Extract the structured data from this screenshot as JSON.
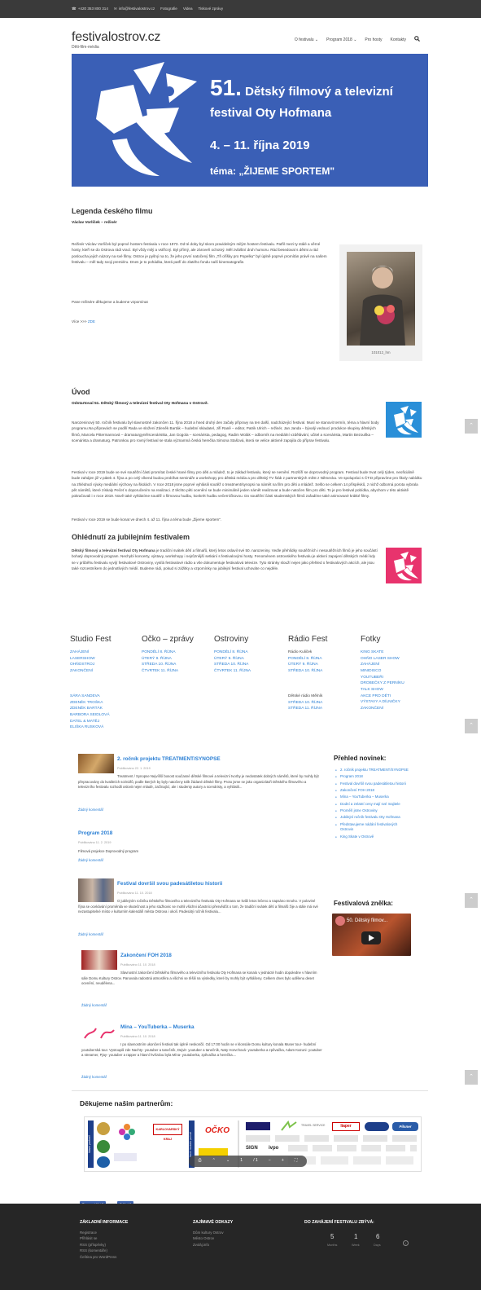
{
  "topbar": {
    "phone": "+420 353 800 314",
    "email": "info@festivalostrov.cz",
    "links": [
      "Fotografie",
      "Videa",
      "Tiskové zprávy"
    ]
  },
  "site": {
    "title": "festivalostrov.cz",
    "subtitle": "Děti-film-média"
  },
  "nav": {
    "items": [
      "O festivalu",
      "Program 2018",
      "Pro hosty",
      "Kontakty"
    ]
  },
  "banner": {
    "number": "51.",
    "line1": "Dětský filmový a televizní",
    "line2": "festival Oty Hofmana",
    "dates": "4. – 11. října 2019",
    "theme": "téma: „ŽIJEME SPORTEM\""
  },
  "legenda": {
    "title": "Legenda českého filmu",
    "subtitle": "Václav Vorlíček – režisér",
    "text": "Režisér Václav Vorlíček byl poprvé hostem festivalu v roce 1973. Od té doby byl skoro pravidelným milým hostem festivalu. Patřil mezi ty stálé a věrné hosty, kteří se do Ostrova rádi vrací. Byl vždy milý a vstřícný. Byl přímý, ale zároveň ochotný. Měl zvláštní druh humoru. Rád besedoval s dětmi a rád posloucha jejich názory na své filmy. Ostrov je pyšný na to, že jeho první natočený film „Tři oříšky pro Popelku\" byl úplně poprvé promítán právě na našem festivalu – měl tady svoji premiéru. Dnes je to pohádka, která patří do zlatého fondu naší kinematografie.",
    "thanks": "Pane režisére děkujeme a budeme vzpomínat",
    "more": "Více >>>",
    "more_link": "ZDE",
    "photo_caption": "101012_hm"
  },
  "uvod": {
    "title": "Úvod",
    "subtitle": "Odstartoval 51. Dětský filmový a televizní festival Oty Hofmana v Ostrově.",
    "p1": "Narozeninový 50. ročník festivalu byl slavnostně zakončen 11. října 2018 a hned druhý den začaly přípravy na ten další, nadcházející festival. Musí se stanovit termín, téma a hlavní body programu.Na přípravách se podílí Rada ve složení Zdeněk Barták – hudební skladatel, Jiří Raně – editor, Patrik Ulrich – režisér, Jan Janda – bývalý vedoucí produkce skupiny dětských filmů, Marcela Pittermannová – dramaturgyně/scenáristka, Jan Gogola – scenárista, pedagog, Radim Wolák – odborník na mediální vzdělávání, učitel a scenárista, Martin Bezouška – scenárista a dramaturg. Patronkou pro rovný festival se stala významná česká herečka Simona Stašová, která se velice aktivně zapojila do příprav festivalu.",
    "p2": "Festival v roce 2019 bude ve své soutěžní části promítat české hrané filmy pro děti a mládež, to je základ festivalu, který se nemění. Rozšíří se doprovodný program. Festival bude trvat celý týden, neoficiálně bude zahájen již v pátek 4. října a po celý víkend budou probíhat semináře a workshopy pro dětská média a pro dětský TV štáb z partnerských měst z Německa. Ve spolupráci s ČT:D připravíme pro školy nabídku na zhlédnutí výuky mediální výchovy na školách. V roce 2018 jsme poprvé vyhlásili soutěž o treatment/synopsi na námět na film pro děti a mládež. Sešlo se celkem 14 příspěvků, z nichž odborná porota vybrala pět námětů, které získaly Pečeť s doporučením na realizaci. Z těchto pěti ocenění se bude minimálně jeden námět realizovat a bude natočen film pro děti. To je pro festival pobídka, abychom v této aktivitě pokračovali i v roce 2019. Nově také vyhlásíme soutěž o filmovou hudbu, konkrét hudbu večerníčkovou. Do soutěžní části studentských filmů zařadíme také animované krátké filmy.",
    "p3": "Festival v roce 2019 se bude konat ve dnech 4. až 11. října a téma bude „Žijeme sportem\"."
  },
  "ohlednuti": {
    "title": "Ohlédnutí za jubilejním festivalem",
    "lead": "Dětský filmový a televizní festival Oty Hofmana",
    "text": " je tradiční svátek dětí a filmařů, který letos oslavil své 50. narozeniny. Vedle přehlídky soutěžních i nesoutěžních filmů je jeho součástí bohatý doprovodný program. Nechybí koncerty, výstavy, workshopy i nejrůznější setkání s festivalovými hosty. Fenoménem ostrovského festivalu je aktivní zapojení dětských médií kdy se v průběhu festivalu vyvíjí festivalové Ostroviny, vysílá festivalové rádio a vše dokumentuje festivalová televize. Tyto stránky slouží nejen jako přehled o festivalových akcích, ale jsou také rozcestníkem do jednotlivých médií. Budeme rádi, pokud si zážitky a vzpomínky na jubilejní festival uchováte co nejdéle."
  },
  "columns": [
    {
      "title": "Studio Fest",
      "items": [
        "ZAHÁJENÍ",
        "LASERSHOW",
        "OHŇOSTROJ",
        "ZAKONČENÍ"
      ],
      "items2": [
        "SÁRA SANDEVA",
        "ZDENĚK TROŠKA",
        "ZDENĚK BARTÁK",
        "BARBORA SEIDLOVÁ",
        "DATEL & MATĚJ",
        "ELIŠKA RUSKOVÁ"
      ]
    },
    {
      "title": "Očko – zprávy",
      "items": [
        "PONDĚLÍ 8. ŘÍJNA",
        "ÚTERÝ 9. ŘÍJNA",
        "STŘEDA 10. ŘÍJNA",
        "ČTVRTEK 11. ŘÍJNA"
      ]
    },
    {
      "title": "Ostroviny",
      "items": [
        "PONDĚLÍ 8. ŘÍJNA",
        "ÚTERÝ 9. ŘÍJNA",
        "STŘEDA 10. ŘÍJNA",
        "ČTVRTEK 11. ŘÍJNA"
      ]
    },
    {
      "title": "Rádio Fest",
      "plain1": "Rádio Kuliček",
      "items": [
        "PONDĚLÍ 8. ŘÍJNA",
        "ÚTERÝ 9. ŘÍJNA",
        "STŘEDA 10. ŘÍJNA"
      ],
      "plain2": "Dětské rádio Mělník",
      "items2": [
        "STŘEDA 10. ŘÍJNA",
        "STŘEDA 11. ŘÍJNA"
      ]
    },
    {
      "title": "Fotky",
      "items": [
        "KING SKATE",
        "OHŇO LASER SHOW",
        "ZAHÁJENÍ",
        "MINIDISCO",
        "YOUTUBEŘI",
        "DROBEČKY Z PERNÍKU",
        "TALK SHOW",
        "AKCE PRO DĚTI",
        "VÝSTAVY A DÍLNIČKY",
        "ZAKONČENÍ"
      ]
    }
  ],
  "posts": [
    {
      "title": "2. ročník projektu TREATMENT/SYNOPSE",
      "meta": "Publikováno 22. 1. 2019",
      "text": "Treatment / Synopse Nejvíšší bosost současné dětské filmové a televizní tvorby je nedostatek dobrých námětů, které by mohly být přepracovány do kvalitních scénářů, podle kterých by byly natočeny tolik žádané dětské filmy. Proto jsme se jako organizátoři Dětského filmového a televizního festivalu rozhodli oslovit nejen mladé, začínající, ale i studenty autory a scenáristy, a vyhlásili...",
      "link": "Žádný komentář"
    },
    {
      "title": "Program 2018",
      "meta": "Publikováno 11. 2. 2019",
      "text": "Filmová projekce Doprovodný program",
      "link": "Žádný komentář"
    },
    {
      "title": "Festival dovršil svou padesátiletou historii",
      "meta": "Publikováno 11. 10. 2018",
      "text": "O jubilejním ročníku Dětského filmového a televizního festivalu Oty Hofmana se kvůli letos lečeno a napsáno mnoho. V poloviné října se ocekávání proměnila ve skutečnost a jeho stužkovic se mohli všichni účastníci přesvědčit o tom, že tradiční svátek dětí a filmařů žije a stále má své nezastupitelné místo v kulturním kalendáři města Ostrova i okolí. Padesátý ročník festivalu...",
      "link": "Žádný komentář"
    },
    {
      "title": "Zakončení FOH 2018",
      "meta": "Publikováno 11. 10. 2018",
      "text": "Slavnostní zakončení Dětského filmového a televizního festivalu Oty Hofmana se konalo v jednácté hodin dopoledne v hlavním sále Domu Kultury Ostrov. Panovala radostná atmosféra a všichni se těšili na výsledky, které by mohly být vyhlášeny. Celkem dnes bylo udělenu deset ocenění, neudělena...",
      "link": "Žádný komentář"
    },
    {
      "title": "Mína – YouTuberka – Muserka",
      "meta": "Publikováno 11. 10. 2018",
      "text": "I po slavnostním ukončení festival tak úplně neskončil. Od 17:00 hodin se v klonsále Domu kultury konala Muser tour- hudební youtuberská tour. Vystoupili zde Nachty- youtuber a tanečník, Dejvit- youtuber a tanečník, Naty Horvchová- youtuberka a zpěvačka, Adam Kazuni- youtuber a streamer, Pjay- youtuber a rapper a hlavní hvězdou byla Mína- youtuberka, zpěvačka a herečka....",
      "link": "Žádný komentář"
    }
  ],
  "sidebar": {
    "news_title": "Přehled novinek:",
    "news": [
      "2. ročník projektu TREATMENT/SYNOPSE",
      "Program 2018",
      "Festival dovršil svou padesátiletou historii",
      "Zakončení FOH 2018",
      "Mína – YouTuberka – Muserka",
      "Dodní a zelatní cesy mají své majitele",
      "Proměň jsme Ostroviny",
      "Jubilejní ročník festivalu Oty Hofmana",
      "Představujeme nádání festivalových Ostrovin",
      "King Skate v Ostrově"
    ],
    "video_title": "Festivalová znělka:",
    "video_label": "50. Dětský filmov..."
  },
  "partners": {
    "title": "Děkujeme našim partnerům:",
    "labels": [
      "hlavní partneři",
      "hlavní mediální partneři",
      "KARLOVARSKÝ KRAJ",
      "OČKO",
      "TRAVEL SERVICE",
      "liaper",
      "Pilsner",
      "SIGN",
      "ivpo"
    ]
  },
  "pdfbar": {
    "page": "1",
    "total": "/ 1"
  },
  "social": {
    "like": "To se mi líbí 3",
    "share": "Sdílet 3"
  },
  "footer": {
    "col1_title": "Základní informace",
    "col1_items": [
      "Registrace",
      "Přihlásit se",
      "RSS (příspěvky)",
      "RSS (komentáře)",
      "Čeština pro WordPress"
    ],
    "col2_title": "Zajímavé odkazy",
    "col2_items": [
      "Dům kultury Ostrov",
      "Město Ostrov",
      "Zvoláj.info"
    ],
    "col3_title": "Do zahájení festivalu zbývá:",
    "countdown": [
      {
        "num": "5",
        "label": "Months"
      },
      {
        "num": "1",
        "label": "Week"
      },
      {
        "num": "6",
        "label": "Days"
      }
    ]
  },
  "colors": {
    "banner": "#3a5fb6",
    "link": "#2a7fd4",
    "footer": "#262626",
    "topbar": "#3a3a3a",
    "pink": "#e8336d"
  }
}
